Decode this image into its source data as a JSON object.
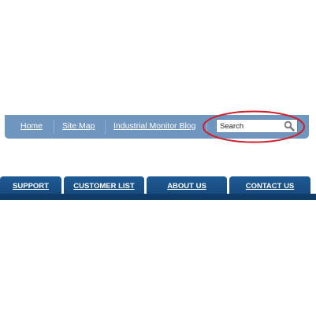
{
  "utility_nav": {
    "links": [
      "Home",
      "Site Map",
      "Industrial Monitor Blog"
    ],
    "search_placeholder": "Search"
  },
  "main_nav": {
    "tabs": [
      "SUPPORT",
      "CUSTOMER LIST",
      "ABOUT US",
      "CONTACT US"
    ]
  },
  "colors": {
    "utility_bar": "#6f96bf",
    "nav_tab": "#1d5b95",
    "nav_strip": "#0f3b6b",
    "highlight": "#d0202a"
  }
}
